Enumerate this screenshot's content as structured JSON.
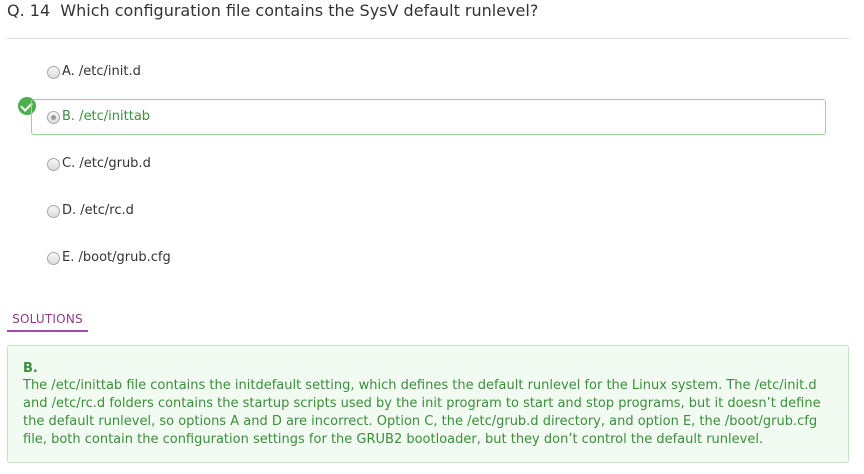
{
  "question": {
    "number": "Q. 14",
    "text": "Which configuration file contains the SysV default runlevel?"
  },
  "options": [
    {
      "label": "A. /etc/init.d",
      "selected": false
    },
    {
      "label": "B. /etc/inittab",
      "selected": true,
      "correct": true
    },
    {
      "label": "C. /etc/grub.d",
      "selected": false
    },
    {
      "label": "D. /etc/rc.d",
      "selected": false
    },
    {
      "label": "E. /boot/grub.cfg",
      "selected": false
    }
  ],
  "solutions": {
    "tab_label": "SOLUTIONS",
    "answer": "B.",
    "explanation": "The /etc/inittab file contains the initdefault setting, which defines the default runlevel for the Linux system. The /etc/init.d and /etc/rc.d folders contains the startup scripts used by the init program to start and stop programs, but it doesn’t define the default runlevel, so options A and D are incorrect. Option C, the /etc/grub.d directory, and option E, the /boot/grub.cfg file, both contain the configuration settings for the GRUB2 bootloader, but they don’t control the default runlevel."
  },
  "colors": {
    "correct_green": "#4cae4c",
    "solution_text": "#3a8f3a",
    "tab_purple": "#8e3c8e"
  },
  "icons": {
    "correct_badge": "check-circle-icon"
  }
}
